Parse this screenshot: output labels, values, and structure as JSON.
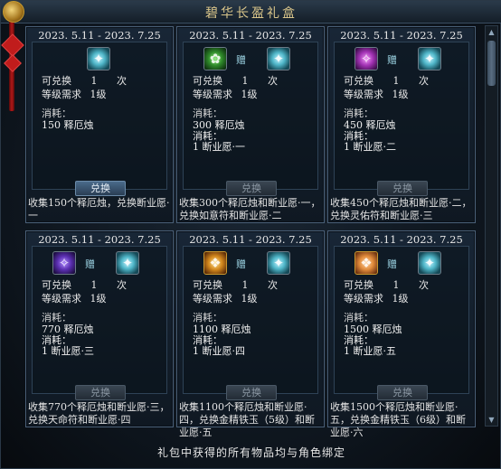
{
  "window": {
    "title": "碧华长盈礼盒"
  },
  "labels": {
    "exchangeable": "可兑换",
    "times_unit": "次",
    "level_req": "等级需求",
    "cost": "消耗：",
    "gift": "赠"
  },
  "cards": [
    {
      "date": "2023. 5.11 - 2023. 7.25",
      "count": "1",
      "level": "1级",
      "cost_lines": [
        "150 释厄烛"
      ],
      "button": "兑换",
      "button_active": true,
      "desc": "收集150个释厄烛，兑换断业愿·一",
      "icons": [
        "target-item-icon"
      ]
    },
    {
      "date": "2023. 5.11 - 2023. 7.25",
      "count": "1",
      "level": "1级",
      "cost_lines": [
        "300 释厄烛",
        "消耗：",
        "1 断业愿·一"
      ],
      "button": "兑换",
      "button_active": false,
      "desc": "收集300个释厄烛和断业愿·一，兑换如意符和断业愿·二",
      "icons": [
        "ruyi-talisman-icon",
        "target-item-icon"
      ]
    },
    {
      "date": "2023. 5.11 - 2023. 7.25",
      "count": "1",
      "level": "1级",
      "cost_lines": [
        "450 释厄烛",
        "消耗：",
        "1 断业愿·二"
      ],
      "button": "兑换",
      "button_active": false,
      "desc": "收集450个释厄烛和断业愿·二，兑换灵佑符和断业愿·三",
      "icons": [
        "lingyou-talisman-icon",
        "target-item-icon"
      ]
    },
    {
      "date": "2023. 5.11 - 2023. 7.25",
      "count": "1",
      "level": "1级",
      "cost_lines": [
        "770 释厄烛",
        "消耗：",
        "1 断业愿·三"
      ],
      "button": "兑换",
      "button_active": false,
      "desc": "收集770个释厄烛和断业愿·三，兑换天命符和断业愿·四",
      "icons": [
        "tianming-talisman-icon",
        "target-item-icon"
      ]
    },
    {
      "date": "2023. 5.11 - 2023. 7.25",
      "count": "1",
      "level": "1级",
      "cost_lines": [
        "1100 释厄烛",
        "消耗：",
        "1 断业愿·四"
      ],
      "button": "兑换",
      "button_active": false,
      "desc": "收集1100个释厄烛和断业愿·四，兑换金精铁玉（5级）和断业愿·五",
      "icons": [
        "jade-lv5-icon",
        "target-item-icon"
      ]
    },
    {
      "date": "2023. 5.11 - 2023. 7.25",
      "count": "1",
      "level": "1级",
      "cost_lines": [
        "1500 释厄烛",
        "消耗：",
        "1 断业愿·五"
      ],
      "button": "兑换",
      "button_active": false,
      "desc": "收集1500个释厄烛和断业愿·五，兑换金精铁玉（6级）和断业愿·六",
      "icons": [
        "jade-lv6-icon",
        "target-item-icon"
      ]
    }
  ],
  "footer": {
    "note": "礼包中获得的所有物品均与角色绑定"
  }
}
